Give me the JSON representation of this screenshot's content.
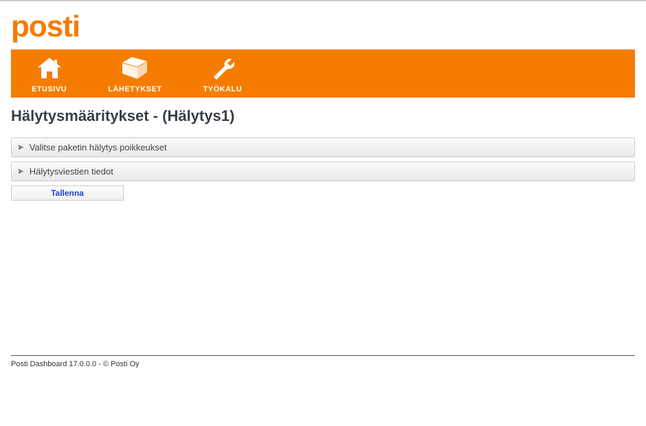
{
  "logo": {
    "text": "posti"
  },
  "nav": {
    "items": [
      {
        "label": "ETUSIVU"
      },
      {
        "label": "LÄHETYKSET"
      },
      {
        "label": "TYÖKALU"
      }
    ]
  },
  "page": {
    "title": "Hälytysmääritykset - (Hälytys1)"
  },
  "accordion": {
    "items": [
      {
        "label": "Valitse paketin hälytys poikkeukset"
      },
      {
        "label": "Hälytysviestien tiedot"
      }
    ]
  },
  "actions": {
    "save_label": "Tallenna"
  },
  "footer": {
    "text": "Posti Dashboard 17.0.0.0 - © Posti Oy"
  }
}
